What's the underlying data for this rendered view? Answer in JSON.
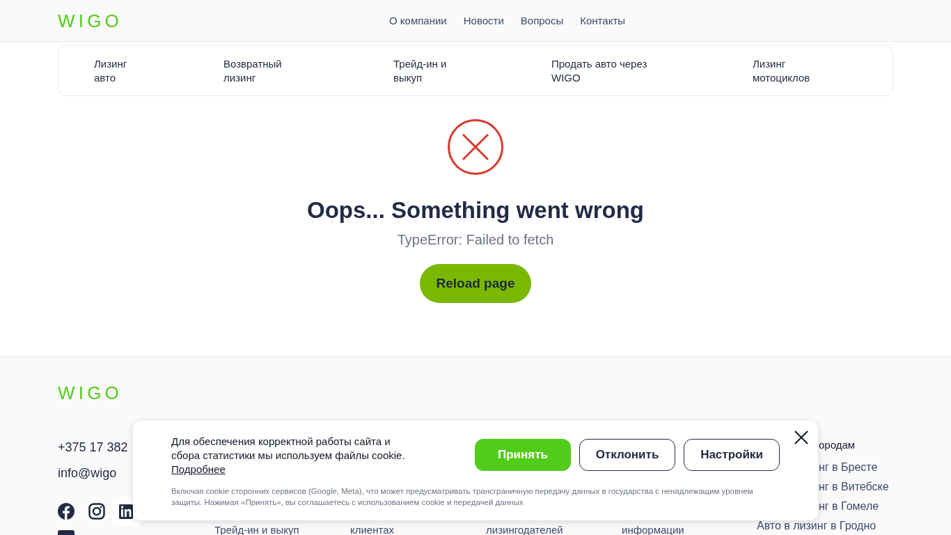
{
  "header": {
    "logo": "WIGO",
    "nav": [
      "О компании",
      "Новости",
      "Вопросы",
      "Контакты"
    ]
  },
  "services": [
    "Лизинг авто",
    "Возвратный лизинг",
    "Трейд-ин и выкуп",
    "Продать авто через WIGO",
    "Лизинг мотоциклов"
  ],
  "error": {
    "title": "Oops... Something went wrong",
    "message": "TypeError: Failed to fetch",
    "button": "Reload page"
  },
  "footer": {
    "logo": "WIGO",
    "phone": "+375 17 382",
    "email": "info@wigo",
    "links": [
      "Трейд-ин и выкуп",
      "клиентах",
      "лизингодателей",
      "информации"
    ],
    "cities": {
      "heading": "ородам",
      "items": [
        "нг в Бресте",
        "нг в Витебске",
        "нг в Гомеле"
      ],
      "last": "Авто в лизинг в Гродно"
    }
  },
  "cookie": {
    "text": "Для обеспечения корректной работы сайта и сбора статистики мы используем файлы cookie.",
    "link": "Подробнее",
    "note": "Включая cookie сторонних сервисов (Google, Meta), что может предусматривать трансграничную передачу данных в государства с ненадлежащим уровнем защиты. Нажимая «Принять», вы соглашаетесь с использованием cookie и передачей данных",
    "buttons": [
      {
        "label": "Принять",
        "kind": "primary"
      },
      {
        "label": "Отклонить",
        "kind": "outline"
      },
      {
        "label": "Настройки",
        "kind": "outline"
      }
    ]
  }
}
